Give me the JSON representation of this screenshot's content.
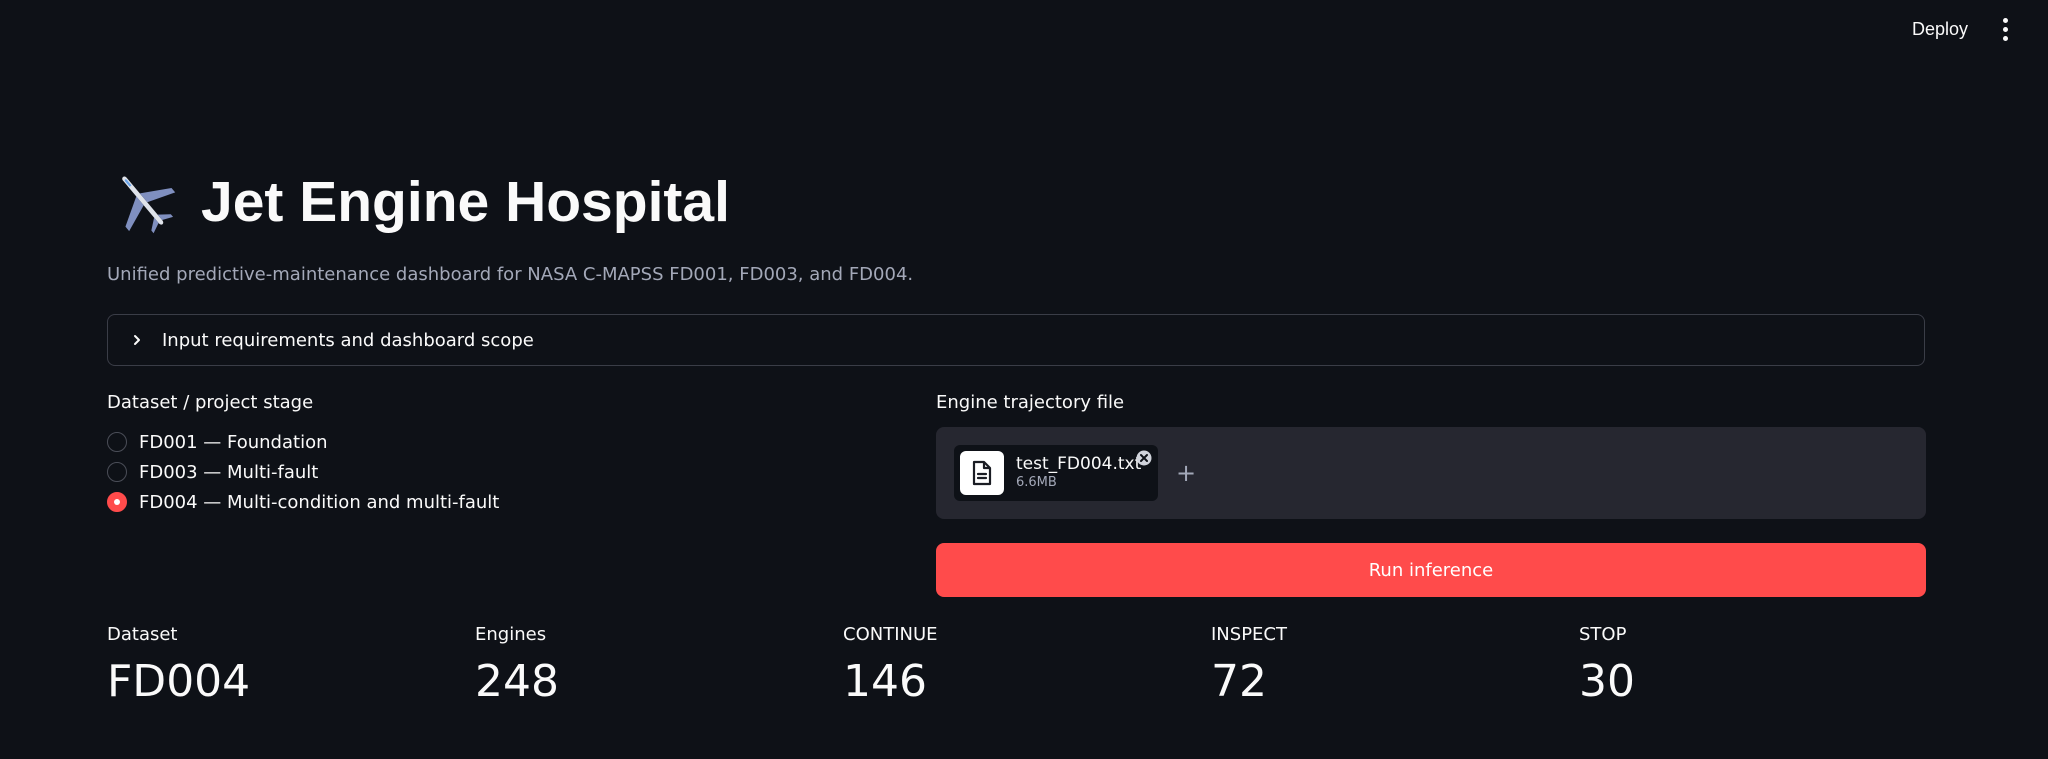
{
  "header": {
    "deploy_label": "Deploy",
    "menu_icon": "vertical-dots-icon"
  },
  "page": {
    "title": "Jet Engine Hospital",
    "title_icon": "airplane-icon",
    "subtitle": "Unified predictive-maintenance dashboard for NASA C-MAPSS FD001, FD003, and FD004."
  },
  "expander": {
    "label": "Input requirements and dashboard scope",
    "icon": "chevron-right-icon"
  },
  "dataset_radio": {
    "label": "Dataset / project stage",
    "selected_index": 2,
    "options": [
      "FD001 — Foundation",
      "FD003 — Multi-fault",
      "FD004 — Multi-condition and multi-fault"
    ]
  },
  "uploader": {
    "label": "Engine trajectory file",
    "file_name": "test_FD004.txt",
    "file_size": "6.6MB",
    "add_symbol": "+"
  },
  "run_button": {
    "label": "Run inference",
    "color": "#ff4b4b"
  },
  "metrics": [
    {
      "label": "Dataset",
      "value": "FD004"
    },
    {
      "label": "Engines",
      "value": "248"
    },
    {
      "label": "CONTINUE",
      "value": "146"
    },
    {
      "label": "INSPECT",
      "value": "72"
    },
    {
      "label": "STOP",
      "value": "30"
    }
  ],
  "colors": {
    "background": "#0e1117",
    "accent": "#ff4b4b",
    "panel": "#262730",
    "muted_text": "#a3a8b8"
  }
}
